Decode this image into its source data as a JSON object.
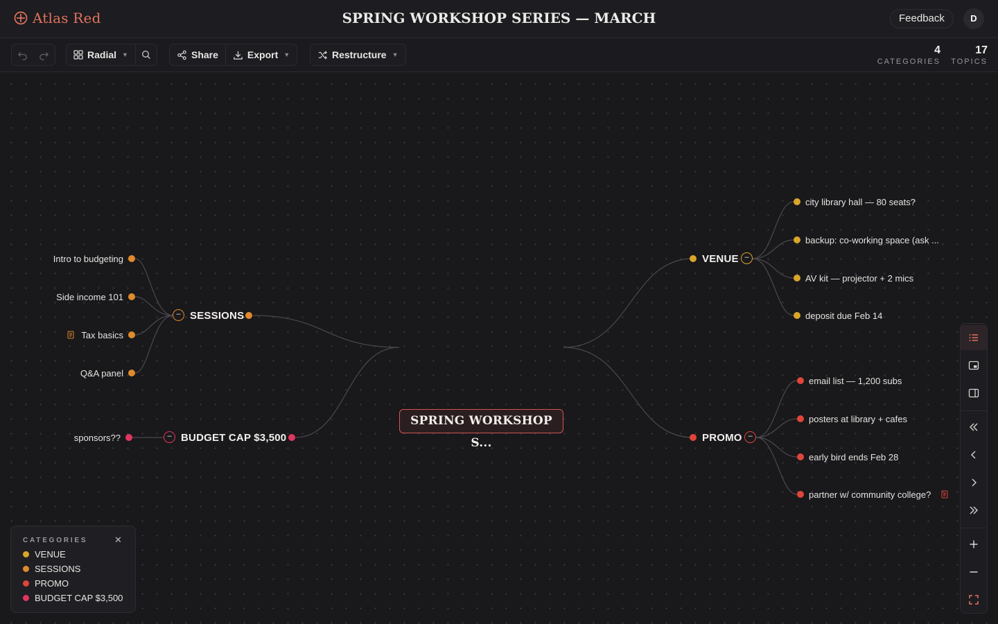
{
  "app": {
    "name": "Atlas Red",
    "brand_color": "#e0735e",
    "logo_icon": "crosshair-circle-icon"
  },
  "document": {
    "title": "SPRING WORKSHOP SERIES — MARCH"
  },
  "header": {
    "feedback_label": "Feedback",
    "avatar_initial": "D"
  },
  "toolbar": {
    "undo_icon": "undo-icon",
    "redo_icon": "redo-icon",
    "layout_label": "Radial",
    "search_icon": "search-icon",
    "share_label": "Share",
    "export_label": "Export",
    "restructure_label": "Restructure"
  },
  "stats": {
    "categories_count": "4",
    "categories_label": "CATEGORIES",
    "topics_count": "17",
    "topics_label": "TOPICS"
  },
  "mindmap": {
    "root": "SPRING WORKSHOP S...",
    "categories": {
      "venue": {
        "label": "VENUE",
        "color": "#d9a52a",
        "topics": [
          "city library hall — 80 seats?",
          "backup: co-working space (ask ...",
          "AV kit — projector + 2 mics",
          "deposit due Feb 14"
        ]
      },
      "sessions": {
        "label": "SESSIONS",
        "color": "#e08a2c",
        "topics": [
          "Intro to budgeting",
          "Side income 101",
          "Tax basics",
          "Q&A panel"
        ]
      },
      "promo": {
        "label": "PROMO",
        "color": "#e0453a",
        "topics": [
          "email list — 1,200 subs",
          "posters at library + cafes",
          "early bird ends Feb 28",
          "partner w/ community college?"
        ]
      },
      "budget": {
        "label": "BUDGET CAP $3,500",
        "color": "#e0365e",
        "topics": [
          "sponsors??"
        ]
      }
    }
  },
  "legend": {
    "title": "CATEGORIES",
    "items": [
      {
        "label": "VENUE",
        "color": "#d9a52a"
      },
      {
        "label": "SESSIONS",
        "color": "#e08a2c"
      },
      {
        "label": "PROMO",
        "color": "#e0453a"
      },
      {
        "label": "BUDGET CAP $3,500",
        "color": "#e0365e"
      }
    ]
  },
  "rail": {
    "buttons": [
      "outline-icon",
      "minimap-icon",
      "side-panel-icon",
      "collapse-all-icon",
      "collapse-icon",
      "expand-icon",
      "expand-all-icon",
      "zoom-in-icon",
      "zoom-out-icon",
      "fit-screen-icon"
    ]
  }
}
